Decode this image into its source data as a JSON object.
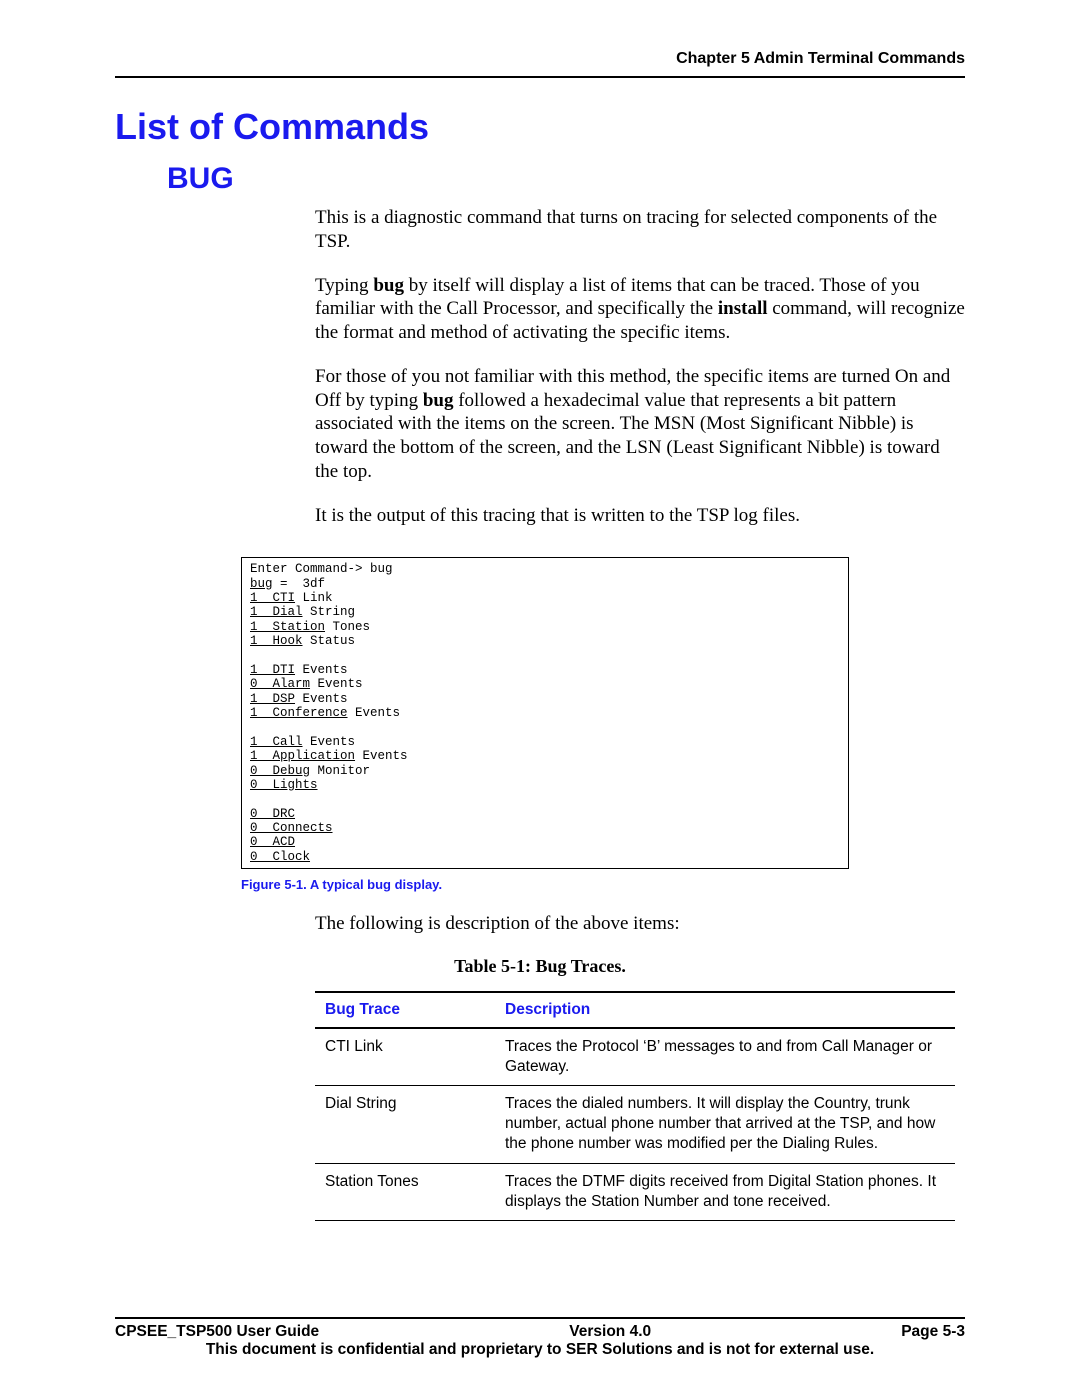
{
  "header": {
    "chapter_line": "Chapter 5 Admin Terminal Commands"
  },
  "h1": "List of Commands",
  "h2": "BUG",
  "body": {
    "p1_a": "This is a diagnostic command that turns on tracing for selected components of the TSP.",
    "p2_a": "Typing ",
    "p2_bold1": "bug",
    "p2_b": " by itself will display a list of items that can be traced.  Those of you familiar with the Call Processor, and specifically the ",
    "p2_bold2": "install",
    "p2_c": " command, will recognize the format and method of activating the specific items.",
    "p3_a": "For those of you not familiar with this method, the specific items are turned On  and Off by typing ",
    "p3_bold1": "bug",
    "p3_b": " followed a hexadecimal value that represents a bit pattern associated with the items on the screen.  The MSN (Most Significant Nibble) is toward the bottom of the screen, and the LSN (Least Significant Nibble) is toward the top.",
    "p4_a": "It is the output of this tracing that is written to the TSP log files.",
    "after_table_intro": "The following is description of the above items:"
  },
  "figure": {
    "line_cmd": "Enter Command-> bug",
    "line_val_a": "bug",
    "line_val_b": " =  3df",
    "g1_l1_a": "1  CTI",
    "g1_l1_b": " Link",
    "g1_l2_a": "1  Dial",
    "g1_l2_b": " String",
    "g1_l3_a": "1  Station",
    "g1_l3_b": " Tones",
    "g1_l4_a": "1  Hook",
    "g1_l4_b": " Status",
    "g2_l1_a": "1  DTI",
    "g2_l1_b": " Events",
    "g2_l2_a": "0  Alarm",
    "g2_l2_b": " Events",
    "g2_l3_a": "1  DSP",
    "g2_l3_b": " Events",
    "g2_l4_a": "1  Conference",
    "g2_l4_b": " Events",
    "g3_l1_a": "1  Call",
    "g3_l1_b": " Events",
    "g3_l2_a": "1  Application",
    "g3_l2_b": " Events",
    "g3_l3_a": "0  Debug",
    "g3_l3_b": " Monitor",
    "g3_l4_a": "0  Lights",
    "g3_l4_b": "",
    "g4_l1_a": "0  DRC",
    "g4_l1_b": "",
    "g4_l2_a": "0  Connects",
    "g4_l2_b": "",
    "g4_l3_a": "0  ACD",
    "g4_l3_b": "",
    "g4_l4_a": "0  Clock",
    "g4_l4_b": "",
    "caption": "Figure 5-1. A typical bug display."
  },
  "table": {
    "caption": "Table 5-1: Bug Traces.",
    "col1_header": "Bug Trace",
    "col2_header": "Description",
    "rows": [
      {
        "trace": "CTI Link",
        "desc": "Traces the Protocol ‘B’ messages to and from Call Manager or Gateway."
      },
      {
        "trace": "Dial String",
        "desc": "Traces the dialed numbers.  It will display the Country, trunk number, actual phone number that arrived at the TSP, and how the phone number was modified per the Dialing Rules."
      },
      {
        "trace": "Station Tones",
        "desc": "Traces the DTMF digits received from Digital Station phones.  It displays the Station Number and tone received."
      }
    ]
  },
  "footer": {
    "left": "CPSEE_TSP500 User Guide",
    "center": "Version 4.0",
    "right": "Page 5-3",
    "confidential": "This document is confidential and proprietary to SER Solutions and is not for external use."
  }
}
